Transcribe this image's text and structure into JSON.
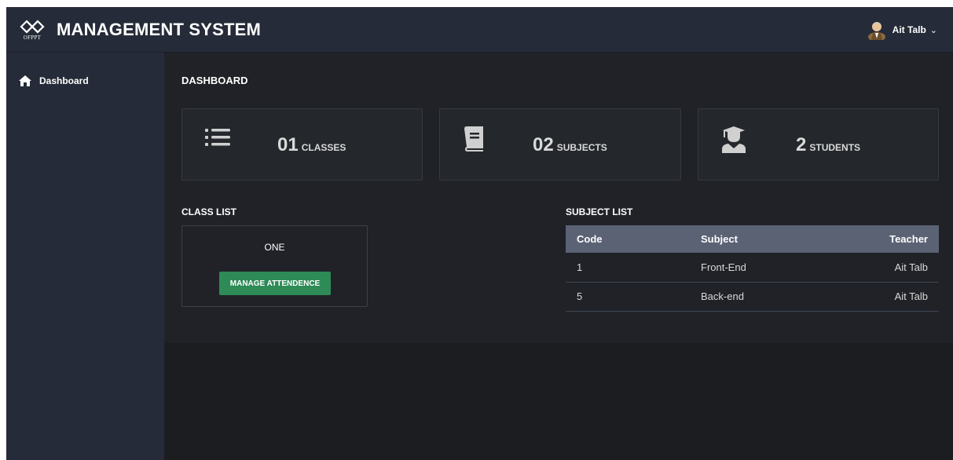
{
  "header": {
    "logo_text": "OFPPT",
    "title": "MANAGEMENT SYSTEM",
    "user_name": "Ait Talb"
  },
  "sidebar": {
    "items": [
      {
        "label": "Dashboard",
        "icon": "home-icon"
      }
    ]
  },
  "main": {
    "page_title": "DASHBOARD",
    "stats": [
      {
        "value": "01",
        "unit": "CLASSES",
        "icon": "list-icon"
      },
      {
        "value": "02",
        "unit": "SUBJECTS",
        "icon": "book-icon"
      },
      {
        "value": "2",
        "unit": "STUDENTS",
        "icon": "graduate-icon"
      }
    ],
    "class_list": {
      "title": "CLASS LIST",
      "classes": [
        {
          "name": "ONE",
          "button_label": "MANAGE ATTENDENCE"
        }
      ]
    },
    "subject_list": {
      "title": "SUBJECT LIST",
      "columns": [
        "Code",
        "Subject",
        "Teacher"
      ],
      "rows": [
        [
          "1",
          "Front-End",
          "Ait Talb"
        ],
        [
          "5",
          "Back-end",
          "Ait Talb"
        ]
      ]
    }
  },
  "colors": {
    "topbar": "#252b38",
    "content_bg": "#202227",
    "card_bg": "#24282c",
    "table_header": "#5a6274",
    "button": "#2e8b57"
  }
}
